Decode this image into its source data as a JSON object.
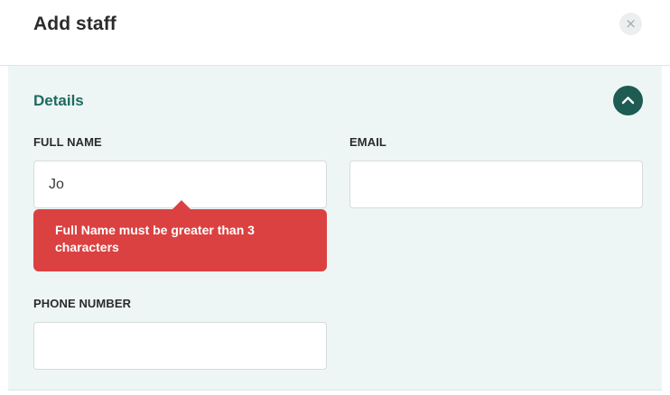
{
  "modal": {
    "title": "Add staff",
    "close_icon_glyph": "×"
  },
  "section": {
    "title": "Details",
    "collapse_icon": "chevron-up-icon",
    "accent_color": "#1e6b62",
    "button_color": "#1d5b53",
    "background_color": "#eef6f5"
  },
  "fields": {
    "full_name": {
      "label": "FULL NAME",
      "value": "Jo",
      "placeholder": ""
    },
    "email": {
      "label": "EMAIL",
      "value": "",
      "placeholder": ""
    },
    "phone": {
      "label": "PHONE NUMBER",
      "value": "",
      "placeholder": ""
    }
  },
  "validation": {
    "full_name_error": "Full Name must be greater than 3 characters",
    "error_color": "#db4141"
  }
}
